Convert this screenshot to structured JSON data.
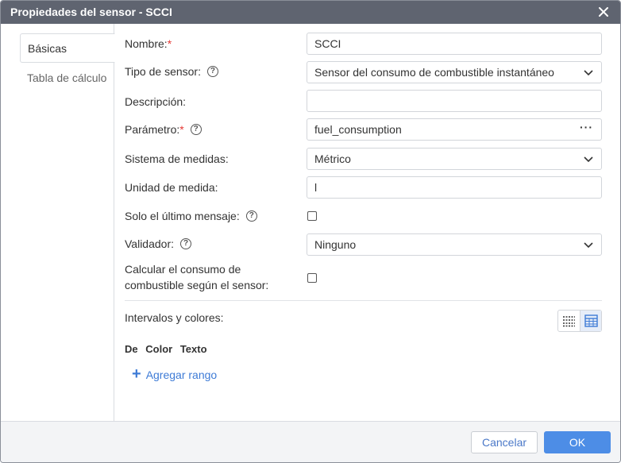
{
  "dialog": {
    "title": "Propiedades del sensor - SCCI"
  },
  "tabs": [
    {
      "label": "Básicas",
      "active": true
    },
    {
      "label": "Tabla de cálculo",
      "active": false
    }
  ],
  "form": {
    "name": {
      "label": "Nombre:",
      "required": "*",
      "value": "SCCI"
    },
    "sensor_type": {
      "label": "Tipo de sensor:",
      "help": "?",
      "value": "Sensor del consumo de combustible instantáneo"
    },
    "description": {
      "label": "Descripción:",
      "value": ""
    },
    "parameter": {
      "label": "Parámetro:",
      "required": "*",
      "help": "?",
      "value": "fuel_consumption",
      "more": "···"
    },
    "measurement_system": {
      "label": "Sistema de medidas:",
      "value": "Métrico"
    },
    "unit": {
      "label": "Unidad de medida:",
      "value": "l"
    },
    "last_message_only": {
      "label": "Solo el último mensaje:",
      "help": "?",
      "checked": false
    },
    "validator": {
      "label": "Validador:",
      "help": "?",
      "value": "Ninguno"
    },
    "calc_consumption": {
      "label_line1": "Calcular el consumo de",
      "label_line2": "combustible según el sensor:",
      "checked": false
    }
  },
  "intervals": {
    "label": "Intervalos y colores:",
    "columns": [
      "De",
      "Color",
      "Texto"
    ],
    "add_range": "Agregar rango"
  },
  "footer": {
    "cancel": "Cancelar",
    "ok": "OK"
  },
  "colors": {
    "titlebar": "#5f6470",
    "accent": "#4d8de6",
    "link": "#3e7bd6",
    "required": "#e53935"
  }
}
